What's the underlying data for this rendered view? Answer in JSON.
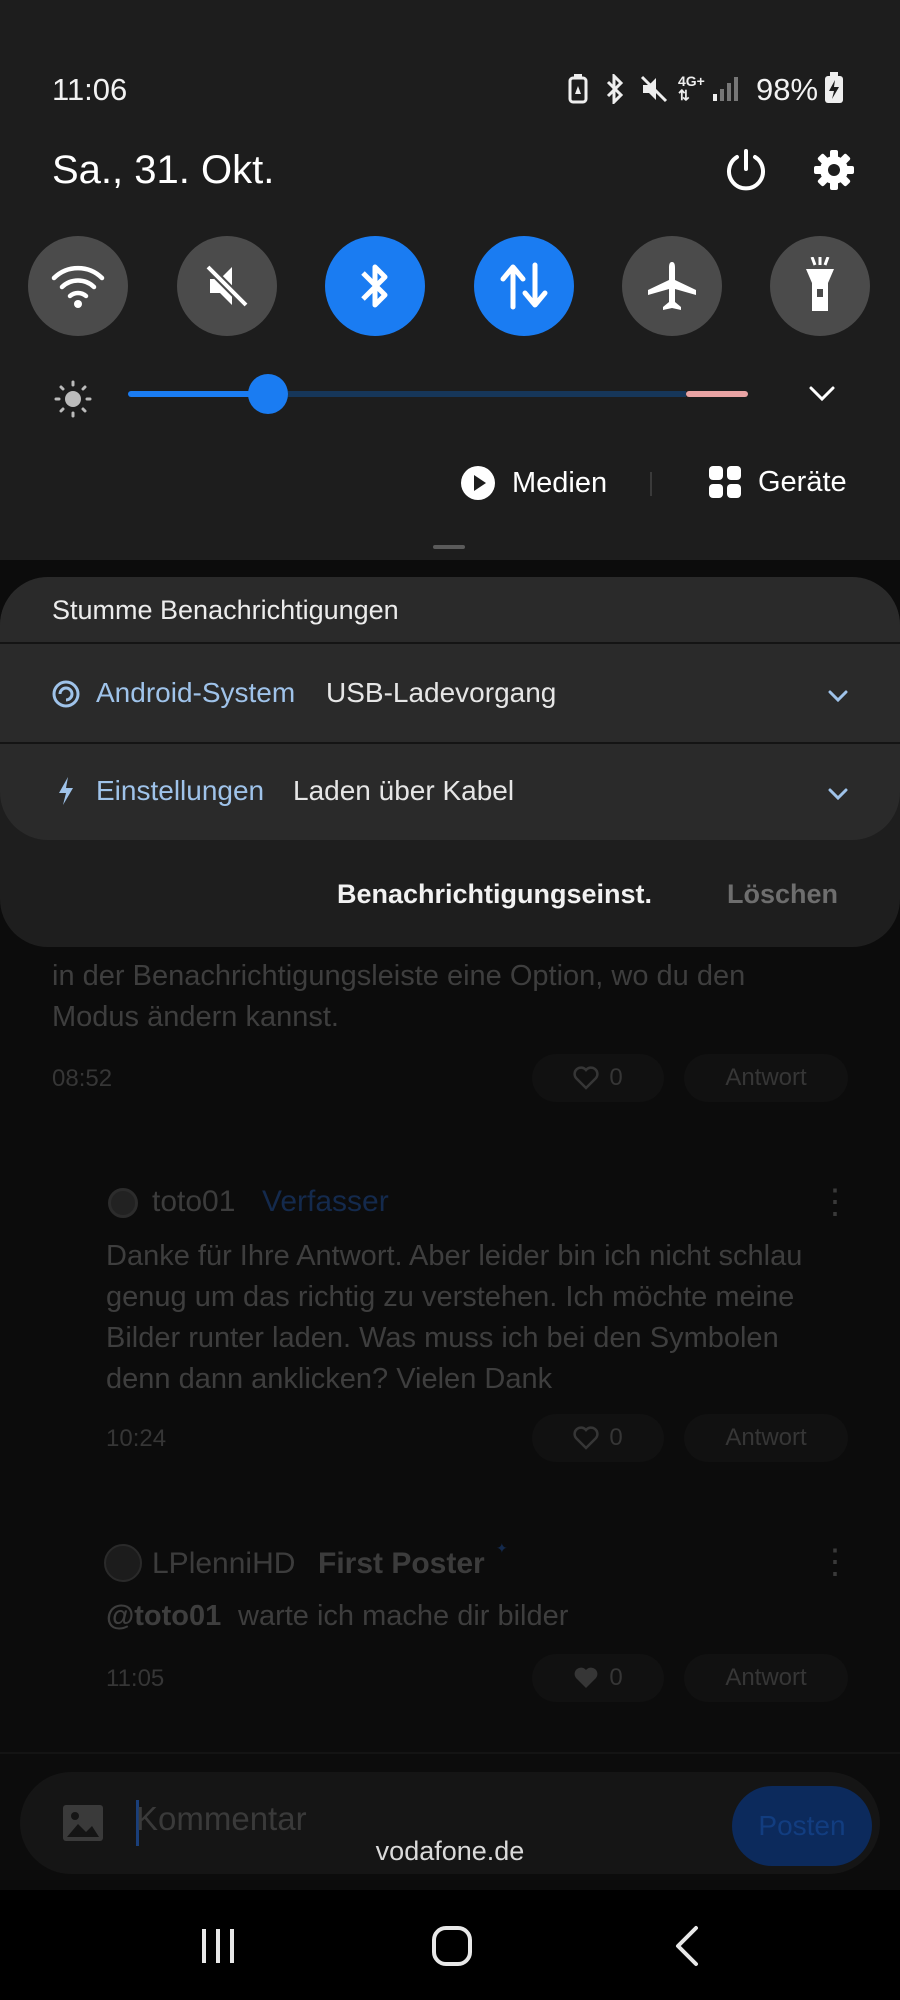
{
  "status_bar": {
    "time": "11:06",
    "battery": "98%"
  },
  "header": {
    "date": "Sa., 31. Okt."
  },
  "quick_toggles": [
    {
      "name": "wifi-toggle",
      "icon": "wifi-icon",
      "active": false
    },
    {
      "name": "sound-toggle",
      "icon": "mute-icon",
      "active": false
    },
    {
      "name": "bluetooth-toggle",
      "icon": "bluetooth-icon",
      "active": true
    },
    {
      "name": "mobile-data-toggle",
      "icon": "data-arrows-icon",
      "active": true
    },
    {
      "name": "airplane-toggle",
      "icon": "airplane-icon",
      "active": false
    },
    {
      "name": "flashlight-toggle",
      "icon": "flashlight-icon",
      "active": false
    }
  ],
  "brightness": {
    "level": 0.23
  },
  "media": {
    "media_label": "Medien",
    "devices_label": "Geräte"
  },
  "notifications": {
    "section_title": "Stumme Benachrichtigungen",
    "items": [
      {
        "app": "Android-System",
        "text": "USB-Ladevorgang"
      },
      {
        "app": "Einstellungen",
        "text": "Laden über Kabel"
      }
    ],
    "settings_action": "Benachrichtigungseinst.",
    "clear_action": "Löschen"
  },
  "background_app": {
    "comment1": {
      "text_lines": [
        "in der Benachrichtigungsleiste eine Option, wo du den",
        "Modus ändern kannst."
      ],
      "time": "08:52",
      "likes": "0",
      "reply": "Antwort"
    },
    "comment2": {
      "author": "toto01",
      "role": "Verfasser",
      "text_lines": [
        "Danke für Ihre Antwort. Aber leider bin ich nicht schlau",
        "genug um das richtig zu verstehen. Ich möchte meine",
        "Bilder runter laden. Was muss ich bei den Symbolen",
        "denn dann anklicken? Vielen Dank"
      ],
      "time": "10:24",
      "likes": "0",
      "reply": "Antwort"
    },
    "comment3": {
      "author": "LPlenniHD",
      "role": "First Poster",
      "mention": "@toto01",
      "text": "warte ich mache dir bilder",
      "time": "11:05",
      "likes": "0",
      "reply": "Antwort"
    },
    "composer": {
      "placeholder": "Kommentar",
      "post_label": "Posten"
    },
    "url_label": "vodafone.de"
  },
  "colors": {
    "accent": "#1a7cf2",
    "link": "#9fc3ea",
    "shade": "#1d1d1d"
  }
}
